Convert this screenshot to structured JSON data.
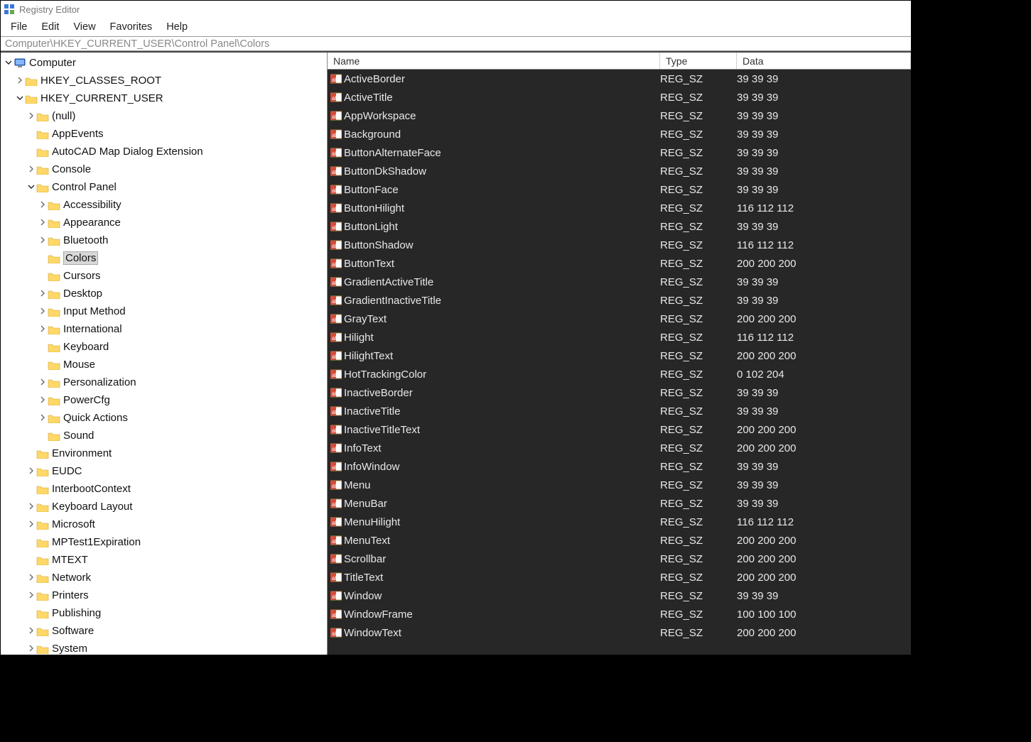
{
  "window": {
    "title": "Registry Editor"
  },
  "menubar": {
    "file": "File",
    "edit": "Edit",
    "view": "View",
    "favorites": "Favorites",
    "help": "Help"
  },
  "address": "Computer\\HKEY_CURRENT_USER\\Control Panel\\Colors",
  "columns": {
    "name": "Name",
    "type": "Type",
    "data": "Data"
  },
  "tree": [
    {
      "depth": 0,
      "twisty": "exp",
      "icon": "computer",
      "label": "Computer"
    },
    {
      "depth": 1,
      "twisty": "col",
      "icon": "folder",
      "label": "HKEY_CLASSES_ROOT"
    },
    {
      "depth": 1,
      "twisty": "exp",
      "icon": "folder",
      "label": "HKEY_CURRENT_USER"
    },
    {
      "depth": 2,
      "twisty": "col",
      "icon": "folder",
      "label": "(null)"
    },
    {
      "depth": 2,
      "twisty": "non",
      "icon": "folder",
      "label": "AppEvents"
    },
    {
      "depth": 2,
      "twisty": "non",
      "icon": "folder",
      "label": "AutoCAD Map Dialog Extension"
    },
    {
      "depth": 2,
      "twisty": "col",
      "icon": "folder",
      "label": "Console"
    },
    {
      "depth": 2,
      "twisty": "exp",
      "icon": "folder",
      "label": "Control Panel"
    },
    {
      "depth": 3,
      "twisty": "col",
      "icon": "folder",
      "label": "Accessibility"
    },
    {
      "depth": 3,
      "twisty": "col",
      "icon": "folder",
      "label": "Appearance"
    },
    {
      "depth": 3,
      "twisty": "col",
      "icon": "folder",
      "label": "Bluetooth"
    },
    {
      "depth": 3,
      "twisty": "non",
      "icon": "folder",
      "label": "Colors",
      "selected": true
    },
    {
      "depth": 3,
      "twisty": "non",
      "icon": "folder",
      "label": "Cursors"
    },
    {
      "depth": 3,
      "twisty": "col",
      "icon": "folder",
      "label": "Desktop"
    },
    {
      "depth": 3,
      "twisty": "col",
      "icon": "folder",
      "label": "Input Method"
    },
    {
      "depth": 3,
      "twisty": "col",
      "icon": "folder",
      "label": "International"
    },
    {
      "depth": 3,
      "twisty": "non",
      "icon": "folder",
      "label": "Keyboard"
    },
    {
      "depth": 3,
      "twisty": "non",
      "icon": "folder",
      "label": "Mouse"
    },
    {
      "depth": 3,
      "twisty": "col",
      "icon": "folder",
      "label": "Personalization"
    },
    {
      "depth": 3,
      "twisty": "col",
      "icon": "folder",
      "label": "PowerCfg"
    },
    {
      "depth": 3,
      "twisty": "col",
      "icon": "folder",
      "label": "Quick Actions"
    },
    {
      "depth": 3,
      "twisty": "non",
      "icon": "folder",
      "label": "Sound"
    },
    {
      "depth": 2,
      "twisty": "non",
      "icon": "folder",
      "label": "Environment"
    },
    {
      "depth": 2,
      "twisty": "col",
      "icon": "folder",
      "label": "EUDC"
    },
    {
      "depth": 2,
      "twisty": "non",
      "icon": "folder",
      "label": "InterbootContext"
    },
    {
      "depth": 2,
      "twisty": "col",
      "icon": "folder",
      "label": "Keyboard Layout"
    },
    {
      "depth": 2,
      "twisty": "col",
      "icon": "folder",
      "label": "Microsoft"
    },
    {
      "depth": 2,
      "twisty": "non",
      "icon": "folder",
      "label": "MPTest1Expiration"
    },
    {
      "depth": 2,
      "twisty": "non",
      "icon": "folder",
      "label": "MTEXT"
    },
    {
      "depth": 2,
      "twisty": "col",
      "icon": "folder",
      "label": "Network"
    },
    {
      "depth": 2,
      "twisty": "col",
      "icon": "folder",
      "label": "Printers"
    },
    {
      "depth": 2,
      "twisty": "non",
      "icon": "folder",
      "label": "Publishing"
    },
    {
      "depth": 2,
      "twisty": "col",
      "icon": "folder",
      "label": "Software"
    },
    {
      "depth": 2,
      "twisty": "col",
      "icon": "folder",
      "label": "System"
    }
  ],
  "values": [
    {
      "name": "ActiveBorder",
      "type": "REG_SZ",
      "data": "39 39 39"
    },
    {
      "name": "ActiveTitle",
      "type": "REG_SZ",
      "data": "39 39 39"
    },
    {
      "name": "AppWorkspace",
      "type": "REG_SZ",
      "data": "39 39 39"
    },
    {
      "name": "Background",
      "type": "REG_SZ",
      "data": "39 39 39"
    },
    {
      "name": "ButtonAlternateFace",
      "type": "REG_SZ",
      "data": "39 39 39"
    },
    {
      "name": "ButtonDkShadow",
      "type": "REG_SZ",
      "data": "39 39 39"
    },
    {
      "name": "ButtonFace",
      "type": "REG_SZ",
      "data": "39 39 39"
    },
    {
      "name": "ButtonHilight",
      "type": "REG_SZ",
      "data": "116 112 112"
    },
    {
      "name": "ButtonLight",
      "type": "REG_SZ",
      "data": "39 39 39"
    },
    {
      "name": "ButtonShadow",
      "type": "REG_SZ",
      "data": "116 112 112"
    },
    {
      "name": "ButtonText",
      "type": "REG_SZ",
      "data": "200 200 200"
    },
    {
      "name": "GradientActiveTitle",
      "type": "REG_SZ",
      "data": "39 39 39"
    },
    {
      "name": "GradientInactiveTitle",
      "type": "REG_SZ",
      "data": "39 39 39"
    },
    {
      "name": "GrayText",
      "type": "REG_SZ",
      "data": "200 200 200"
    },
    {
      "name": "Hilight",
      "type": "REG_SZ",
      "data": "116 112 112"
    },
    {
      "name": "HilightText",
      "type": "REG_SZ",
      "data": "200 200 200"
    },
    {
      "name": "HotTrackingColor",
      "type": "REG_SZ",
      "data": "0 102 204"
    },
    {
      "name": "InactiveBorder",
      "type": "REG_SZ",
      "data": "39 39 39"
    },
    {
      "name": "InactiveTitle",
      "type": "REG_SZ",
      "data": "39 39 39"
    },
    {
      "name": "InactiveTitleText",
      "type": "REG_SZ",
      "data": "200 200 200"
    },
    {
      "name": "InfoText",
      "type": "REG_SZ",
      "data": "200 200 200"
    },
    {
      "name": "InfoWindow",
      "type": "REG_SZ",
      "data": "39 39 39"
    },
    {
      "name": "Menu",
      "type": "REG_SZ",
      "data": "39 39 39"
    },
    {
      "name": "MenuBar",
      "type": "REG_SZ",
      "data": "39 39 39"
    },
    {
      "name": "MenuHilight",
      "type": "REG_SZ",
      "data": "116 112 112"
    },
    {
      "name": "MenuText",
      "type": "REG_SZ",
      "data": "200 200 200"
    },
    {
      "name": "Scrollbar",
      "type": "REG_SZ",
      "data": "200 200 200"
    },
    {
      "name": "TitleText",
      "type": "REG_SZ",
      "data": "200 200 200"
    },
    {
      "name": "Window",
      "type": "REG_SZ",
      "data": "39 39 39"
    },
    {
      "name": "WindowFrame",
      "type": "REG_SZ",
      "data": "100 100 100"
    },
    {
      "name": "WindowText",
      "type": "REG_SZ",
      "data": "200 200 200"
    }
  ]
}
